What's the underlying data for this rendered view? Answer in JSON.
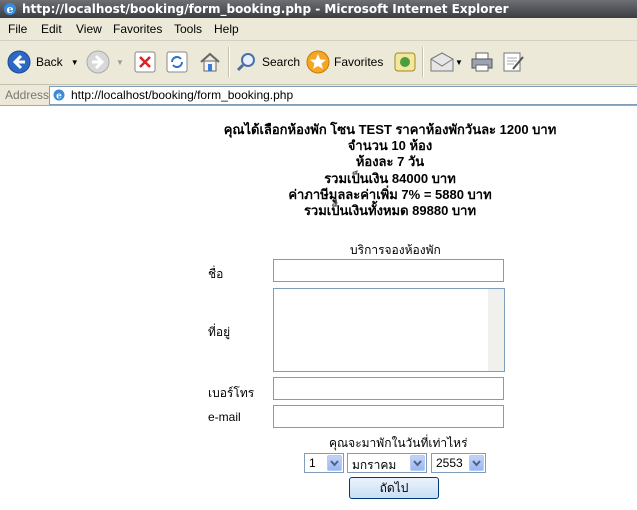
{
  "window": {
    "title": "http://localhost/booking/form_booking.php - Microsoft Internet Explorer"
  },
  "menu": {
    "items": [
      "File",
      "Edit",
      "View",
      "Favorites",
      "Tools",
      "Help"
    ]
  },
  "toolbar": {
    "back_label": "Back",
    "search_label": "Search",
    "favorites_label": "Favorites"
  },
  "address": {
    "label": "Address",
    "url": "http://localhost/booking/form_booking.php"
  },
  "summary": {
    "line1": "คุณได้เลือกห้องพัก โซน TEST ราคาห้องพักวันละ 1200 บาท",
    "line2": "จำนวน 10 ห้อง",
    "line3": "ห้องละ 7 วัน",
    "line4": "รวมเป็นเงิน 84000 บาท",
    "line5": "ค่าภาษีมูลละค่าเพิ่ม 7% = 5880 บาท",
    "line6": "รวมเป็นเงินทั้งหมด 89880 บาท"
  },
  "form": {
    "title": "บริการจองห้องพัก",
    "name_label": "ชื่อ",
    "name_value": "",
    "address_label": "ที่อยู่",
    "address_value": "",
    "phone_label": "เบอร์โทร",
    "phone_value": "",
    "email_label": "e-mail",
    "email_value": "",
    "date_prompt": "คุณจะมาพักในวันที่เท่าไหร่",
    "day": "1",
    "month": "มกราคม",
    "year": "2553",
    "next_label": "ถัดไป"
  }
}
